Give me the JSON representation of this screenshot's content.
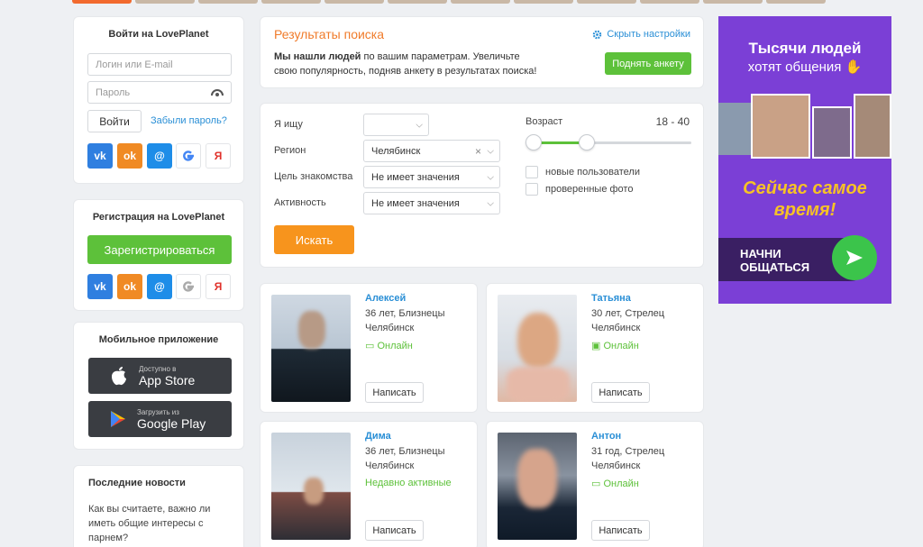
{
  "login": {
    "title": "Войти на LovePlanet",
    "login_placeholder": "Логин или E-mail",
    "password_placeholder": "Пароль",
    "login_button": "Войти",
    "forgot_link": "Забыли пароль?"
  },
  "register": {
    "title": "Регистрация на LovePlanet",
    "button": "Зарегистрироваться"
  },
  "social": {
    "vk": "vk",
    "ok": "ok",
    "mail": "@",
    "google": "G",
    "yandex": "Я"
  },
  "mobile": {
    "title": "Мобильное приложение",
    "appstore_small": "Доступно в",
    "appstore_big": "App Store",
    "gplay_small": "Загрузить из",
    "gplay_big": "Google Play"
  },
  "news": {
    "title": "Последние новости",
    "item": "Как вы считаете, важно ли иметь общие интересы с парнем?"
  },
  "results": {
    "title": "Результаты поиска",
    "hide_settings": "Скрыть настройки",
    "text_bold": "Мы нашли людей",
    "text_rest": " по вашим параметрам. Увеличьте свою популярность, подняв анкету в результатах поиска!",
    "raise_button": "Поднять анкету"
  },
  "search": {
    "seeking_label": "Я ищу",
    "seeking_value": "",
    "region_label": "Регион",
    "region_value": "Челябинск",
    "goal_label": "Цель знакомства",
    "goal_value": "Не имеет значения",
    "activity_label": "Активность",
    "activity_value": "Не имеет значения",
    "age_label": "Возраст",
    "age_range": "18 - 40",
    "age_min": 18,
    "age_max": 40,
    "new_users": "новые пользователи",
    "verified_photo": "проверенные фото",
    "search_button": "Искать"
  },
  "profiles": [
    {
      "name": "Алексей",
      "info": "36 лет, Близнецы",
      "city": "Челябинск",
      "status": "Онлайн",
      "button": "Написать"
    },
    {
      "name": "Татьяна",
      "info": "30 лет, Стрелец",
      "city": "Челябинск",
      "status": "Онлайн",
      "button": "Написать"
    },
    {
      "name": "Дима",
      "info": "36 лет, Близнецы",
      "city": "Челябинск",
      "status": "Недавно активные",
      "button": "Написать"
    },
    {
      "name": "Антон",
      "info": "31 год, Стрелец",
      "city": "Челябинск",
      "status": "Онлайн",
      "button": "Написать"
    }
  ],
  "ad": {
    "headline1": "Тысячи людей",
    "headline2": "хотят общения",
    "slogan1": "Сейчас самое",
    "slogan2": "время!",
    "cta1": "НАЧНИ",
    "cta2": "ОБЩАТЬСЯ"
  }
}
